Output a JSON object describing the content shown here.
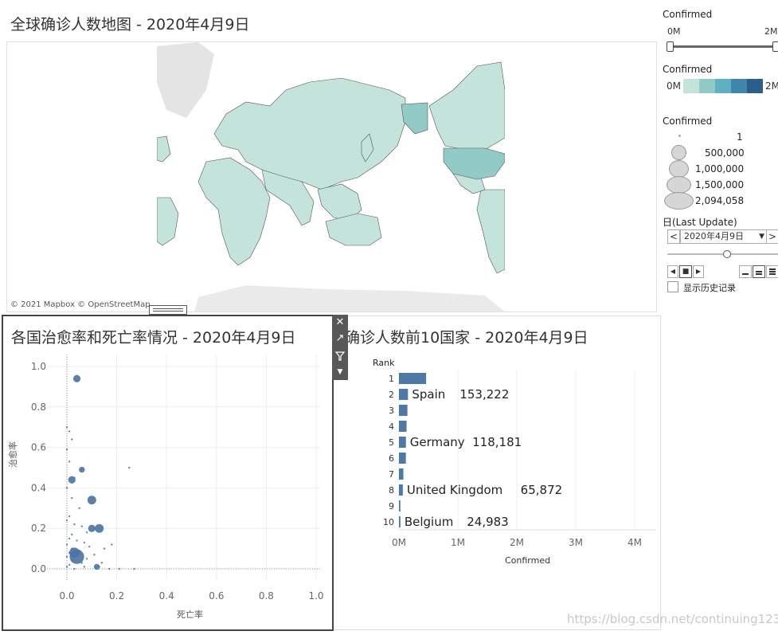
{
  "map": {
    "title": "全球确诊人数地图 - 2020年4月9日",
    "attribution": "© 2021 Mapbox © OpenStreetMap"
  },
  "sidebar": {
    "filter": {
      "title": "Confirmed",
      "min_label": "0M",
      "max_label": "2M"
    },
    "color_legend": {
      "title": "Confirmed",
      "min_label": "0M",
      "max_label": "2M",
      "colors": [
        "#c3e3db",
        "#92cbc6",
        "#5fb0c1",
        "#3f86ab",
        "#2c5e8c"
      ]
    },
    "size_legend": {
      "title": "Confirmed",
      "items": [
        "1",
        "500,000",
        "1,000,000",
        "1,500,000",
        "2,094,058"
      ]
    },
    "date": {
      "title": "日(Last Update)",
      "value": "2020年4月9日",
      "prev": "<",
      "next": ">",
      "dropdown": "▼"
    },
    "history_label": "显示历史记录"
  },
  "scatter": {
    "title": "各国治愈率和死亡率情况 - 2020年4月9日",
    "xlabel": "死亡率",
    "ylabel": "治愈率",
    "xticks": [
      "0.0",
      "0.2",
      "0.4",
      "0.6",
      "0.8",
      "1.0"
    ],
    "yticks": [
      "1.0",
      "0.8",
      "0.6",
      "0.4",
      "0.2",
      "0.0"
    ]
  },
  "bar": {
    "title": "确诊人数前10国家 - 2020年4月9日",
    "rank_header": "Rank",
    "xlabel": "Confirmed",
    "xticks": [
      "0M",
      "1M",
      "2M",
      "3M",
      "4M"
    ]
  },
  "watermark": "https://blog.csdn.net/continuing1234",
  "chart_data": [
    {
      "type": "scatter",
      "title": "各国治愈率和死亡率情况 - 2020年4月9日",
      "xlabel": "死亡率",
      "ylabel": "治愈率",
      "xlim": [
        0,
        1
      ],
      "ylim": [
        0,
        1
      ],
      "points": [
        {
          "x": 0.04,
          "y": 0.94,
          "s": 4
        },
        {
          "x": 0.06,
          "y": 0.49,
          "s": 3
        },
        {
          "x": 0.02,
          "y": 0.44,
          "s": 4
        },
        {
          "x": 0.1,
          "y": 0.34,
          "s": 5
        },
        {
          "x": 0.1,
          "y": 0.2,
          "s": 4
        },
        {
          "x": 0.13,
          "y": 0.2,
          "s": 5
        },
        {
          "x": 0.04,
          "y": 0.06,
          "s": 9
        },
        {
          "x": 0.03,
          "y": 0.08,
          "s": 6
        },
        {
          "x": 0.12,
          "y": 0.01,
          "s": 3
        },
        {
          "x": 0.25,
          "y": 0.5,
          "s": 1
        },
        {
          "x": 0.0,
          "y": 0.7,
          "s": 1
        },
        {
          "x": 0.01,
          "y": 0.68,
          "s": 1
        },
        {
          "x": 0.02,
          "y": 0.64,
          "s": 1
        },
        {
          "x": 0.0,
          "y": 0.59,
          "s": 1
        },
        {
          "x": 0.01,
          "y": 0.53,
          "s": 1
        },
        {
          "x": 0.03,
          "y": 0.45,
          "s": 1
        },
        {
          "x": 0.0,
          "y": 0.4,
          "s": 1
        },
        {
          "x": 0.02,
          "y": 0.35,
          "s": 1
        },
        {
          "x": 0.05,
          "y": 0.3,
          "s": 1
        },
        {
          "x": 0.01,
          "y": 0.26,
          "s": 1
        },
        {
          "x": 0.0,
          "y": 0.24,
          "s": 1
        },
        {
          "x": 0.03,
          "y": 0.22,
          "s": 1
        },
        {
          "x": 0.06,
          "y": 0.21,
          "s": 1
        },
        {
          "x": 0.08,
          "y": 0.18,
          "s": 1
        },
        {
          "x": 0.02,
          "y": 0.17,
          "s": 1
        },
        {
          "x": 0.01,
          "y": 0.15,
          "s": 1
        },
        {
          "x": 0.04,
          "y": 0.14,
          "s": 1
        },
        {
          "x": 0.07,
          "y": 0.13,
          "s": 1
        },
        {
          "x": 0.0,
          "y": 0.12,
          "s": 1
        },
        {
          "x": 0.09,
          "y": 0.11,
          "s": 1
        },
        {
          "x": 0.15,
          "y": 0.1,
          "s": 1
        },
        {
          "x": 0.02,
          "y": 0.1,
          "s": 1
        },
        {
          "x": 0.05,
          "y": 0.09,
          "s": 1
        },
        {
          "x": 0.01,
          "y": 0.08,
          "s": 1
        },
        {
          "x": 0.11,
          "y": 0.07,
          "s": 1
        },
        {
          "x": 0.0,
          "y": 0.06,
          "s": 1
        },
        {
          "x": 0.08,
          "y": 0.05,
          "s": 1
        },
        {
          "x": 0.02,
          "y": 0.04,
          "s": 1
        },
        {
          "x": 0.06,
          "y": 0.03,
          "s": 1
        },
        {
          "x": 0.01,
          "y": 0.02,
          "s": 1
        },
        {
          "x": 0.0,
          "y": 0.01,
          "s": 1
        },
        {
          "x": 0.03,
          "y": 0.0,
          "s": 1
        },
        {
          "x": 0.07,
          "y": 0.01,
          "s": 1
        },
        {
          "x": 0.13,
          "y": 0.01,
          "s": 1
        },
        {
          "x": 0.17,
          "y": 0.0,
          "s": 1
        },
        {
          "x": 0.21,
          "y": 0.0,
          "s": 1
        },
        {
          "x": 0.27,
          "y": 0.0,
          "s": 1
        },
        {
          "x": 0.14,
          "y": 0.03,
          "s": 1
        },
        {
          "x": 0.18,
          "y": 0.12,
          "s": 1
        }
      ]
    },
    {
      "type": "bar",
      "title": "确诊人数前10国家 - 2020年4月9日",
      "xlabel": "Confirmed",
      "ylabel": "Rank",
      "xlim": [
        0,
        4000000
      ],
      "categories": [
        "1",
        "2",
        "3",
        "4",
        "5",
        "6",
        "7",
        "8",
        "9",
        "10"
      ],
      "labels": [
        "",
        "Spain",
        "",
        "",
        "Germany",
        "",
        "",
        "United Kingdom",
        "",
        "Belgium"
      ],
      "values": [
        461000,
        153222,
        143600,
        129000,
        118181,
        117000,
        75000,
        65872,
        24000,
        24983
      ],
      "value_labels": [
        "",
        "153,222",
        "",
        "",
        "118,181",
        "",
        "",
        "65,872",
        "",
        "24,983"
      ]
    }
  ]
}
